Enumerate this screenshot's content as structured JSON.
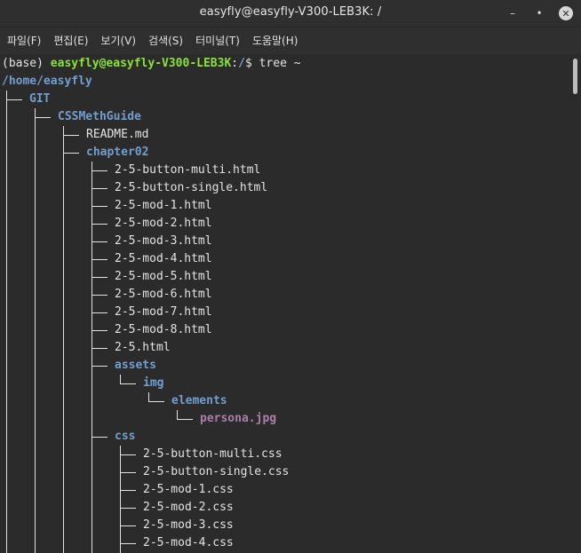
{
  "window": {
    "title": "easyfly@easyfly-V300-LEB3K: /",
    "min_glyph": "–",
    "max_glyph": "•",
    "close_glyph": "✕"
  },
  "menu": [
    "파일(F)",
    "편집(E)",
    "보기(V)",
    "검색(S)",
    "터미널(T)",
    "도움말(H)"
  ],
  "prompt": {
    "env": "(base) ",
    "user_host": "easyfly@easyfly-V300-LEB3K",
    "sep": ":",
    "path": "/",
    "symbol": "$ ",
    "command": "tree ~"
  },
  "tree": {
    "root": "/home/easyfly",
    "entries": [
      {
        "name": "GIT",
        "kind": "dir",
        "depth": 0
      },
      {
        "name": "CSSMethGuide",
        "kind": "dir",
        "depth": 1
      },
      {
        "name": "README.md",
        "kind": "file",
        "depth": 2
      },
      {
        "name": "chapter02",
        "kind": "dir",
        "depth": 2
      },
      {
        "name": "2-5-button-multi.html",
        "kind": "file",
        "depth": 3
      },
      {
        "name": "2-5-button-single.html",
        "kind": "file",
        "depth": 3
      },
      {
        "name": "2-5-mod-1.html",
        "kind": "file",
        "depth": 3
      },
      {
        "name": "2-5-mod-2.html",
        "kind": "file",
        "depth": 3
      },
      {
        "name": "2-5-mod-3.html",
        "kind": "file",
        "depth": 3
      },
      {
        "name": "2-5-mod-4.html",
        "kind": "file",
        "depth": 3
      },
      {
        "name": "2-5-mod-5.html",
        "kind": "file",
        "depth": 3
      },
      {
        "name": "2-5-mod-6.html",
        "kind": "file",
        "depth": 3
      },
      {
        "name": "2-5-mod-7.html",
        "kind": "file",
        "depth": 3
      },
      {
        "name": "2-5-mod-8.html",
        "kind": "file",
        "depth": 3
      },
      {
        "name": "2-5.html",
        "kind": "file",
        "depth": 3
      },
      {
        "name": "assets",
        "kind": "dir",
        "depth": 3
      },
      {
        "name": "img",
        "kind": "dir",
        "depth": 4
      },
      {
        "name": "elements",
        "kind": "dir",
        "depth": 5
      },
      {
        "name": "persona.jpg",
        "kind": "image",
        "depth": 6
      },
      {
        "name": "css",
        "kind": "dir",
        "depth": 3
      },
      {
        "name": "2-5-button-multi.css",
        "kind": "file",
        "depth": 4
      },
      {
        "name": "2-5-button-single.css",
        "kind": "file",
        "depth": 4
      },
      {
        "name": "2-5-mod-1.css",
        "kind": "file",
        "depth": 4
      },
      {
        "name": "2-5-mod-2.css",
        "kind": "file",
        "depth": 4
      },
      {
        "name": "2-5-mod-3.css",
        "kind": "file",
        "depth": 4
      },
      {
        "name": "2-5-mod-4.css",
        "kind": "file",
        "depth": 4
      }
    ]
  },
  "colors": {
    "background": "#2b2b2b",
    "user_host": "#8ae234",
    "directory": "#729fcf",
    "image_file": "#ad7fa8",
    "text": "#e3e3e3"
  }
}
